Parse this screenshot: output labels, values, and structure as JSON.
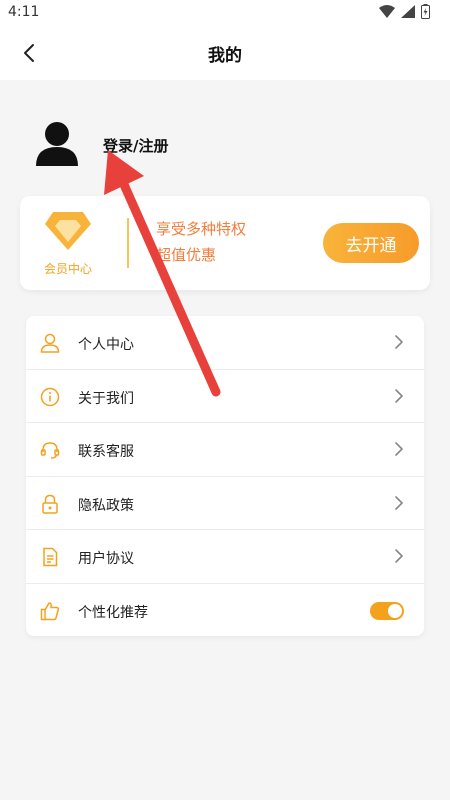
{
  "status": {
    "time": "4:11",
    "icons": [
      "wifi-icon",
      "signal-icon",
      "battery-icon"
    ]
  },
  "header": {
    "back_icon": "chevron-left-icon",
    "title": "我的"
  },
  "profile": {
    "avatar_icon": "user-silhouette-icon",
    "login_label": "登录/注册"
  },
  "vip": {
    "badge_icon": "diamond-icon",
    "badge_label": "会员中心",
    "line1": "享受多种特权",
    "line2": "超值优惠",
    "button_label": "去开通",
    "accent_color": "#f4a21d",
    "text_color": "#f37d3c"
  },
  "menu": {
    "items": [
      {
        "label": "个人中心",
        "icon": "user-outline-icon",
        "trailing": "chevron"
      },
      {
        "label": "关于我们",
        "icon": "info-circle-icon",
        "trailing": "chevron"
      },
      {
        "label": "联系客服",
        "icon": "headset-icon",
        "trailing": "chevron"
      },
      {
        "label": "隐私政策",
        "icon": "lock-icon",
        "trailing": "chevron"
      },
      {
        "label": "用户协议",
        "icon": "document-icon",
        "trailing": "chevron"
      },
      {
        "label": "个性化推荐",
        "icon": "thumbs-up-icon",
        "trailing": "toggle",
        "toggle_on": true
      }
    ]
  },
  "annotation": {
    "arrow_color": "#e8403a"
  }
}
